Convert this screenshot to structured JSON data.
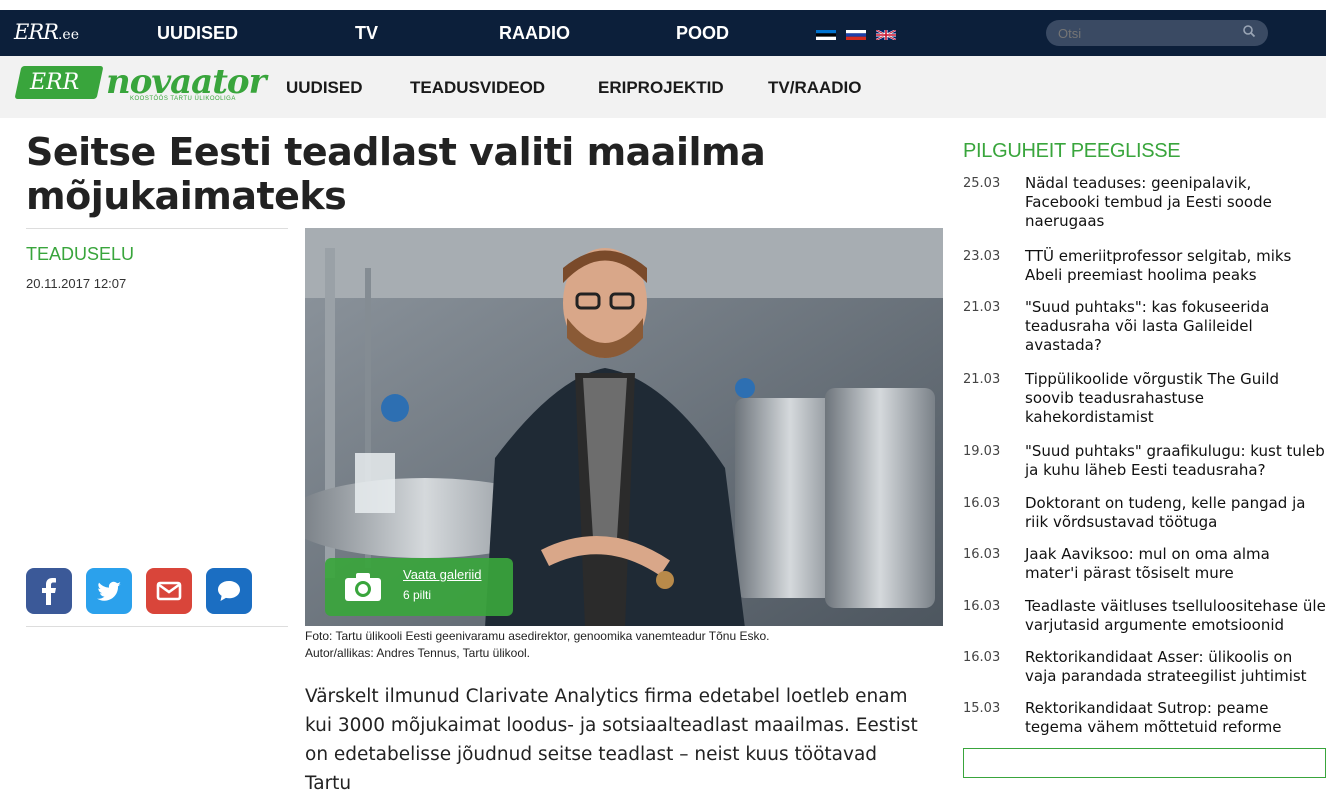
{
  "top_nav": {
    "logo": "ERR",
    "logo_suffix": ".ee",
    "items": [
      "UUDISED",
      "TV",
      "RAADIO",
      "POOD"
    ],
    "search_placeholder": "Otsi"
  },
  "sub_nav": {
    "logo_err": "ERR",
    "logo_name": "novaator",
    "logo_tagline": "KOOSTÖÖS TARTU ÜLIKOOLIGA",
    "items": [
      "UUDISED",
      "TEADUSVIDEOD",
      "ERIPROJEKTID",
      "TV/RAADIO"
    ]
  },
  "article": {
    "title": "Seitse Eesti teadlast valiti maailma mõjukaimateks",
    "category": "TEADUSELU",
    "date": "20.11.2017 12:07",
    "gallery_link": "Vaata galeriid",
    "gallery_count": "6 pilti",
    "caption_line1": "Foto: Tartu ülikooli Eesti geenivaramu asedirektor, genoomika vanemteadur Tõnu Esko.",
    "caption_line2": "Autor/allikas: Andres Tennus, Tartu ülikool.",
    "body": "Värskelt ilmunud Clarivate Analytics firma edetabel loetleb enam kui 3000 mõjukaimat loodus- ja sotsiaalteadlast maailmas. Eestist on edetabelisse jõudnud seitse teadlast – neist kuus töötavad Tartu"
  },
  "social": {
    "icons": [
      "facebook-icon",
      "twitter-icon",
      "email-icon",
      "comment-icon"
    ],
    "colors": [
      "#3b5998",
      "#2ba1ec",
      "#d9453a",
      "#1b6ec2"
    ]
  },
  "sidebar": {
    "title": "PILGUHEIT PEEGLISSE",
    "items": [
      {
        "date": "25.03",
        "title": "Nädal teaduses: geenipalavik, Facebooki tembud ja Eesti soode naerugaas"
      },
      {
        "date": "23.03",
        "title": "TTÜ emeriitprofessor selgitab, miks Abeli preemiast hoolima peaks"
      },
      {
        "date": "21.03",
        "title": "\"Suud puhtaks\": kas fokuseerida teadusraha või lasta Galileidel avastada?"
      },
      {
        "date": "21.03",
        "title": "Tippülikoolide võrgustik The Guild soovib teadusrahastuse kahekordistamist"
      },
      {
        "date": "19.03",
        "title": "\"Suud puhtaks\" graafikulugu: kust tuleb ja kuhu läheb Eesti teadusraha?"
      },
      {
        "date": "16.03",
        "title": "Doktorant on tudeng, kelle pangad ja riik võrdsustavad töötuga"
      },
      {
        "date": "16.03",
        "title": "Jaak Aaviksoo: mul on oma alma mater'i pärast tõsiselt mure"
      },
      {
        "date": "16.03",
        "title": "Teadlaste väitluses tselluloositehase üle varjutasid argumente emotsioonid"
      },
      {
        "date": "16.03",
        "title": "Rektorikandidaat Asser: ülikoolis on vaja parandada strateegilist juhtimist"
      },
      {
        "date": "15.03",
        "title": "Rektorikandidaat Sutrop: peame tegema vähem mõttetuid reforme"
      }
    ]
  },
  "colors": {
    "nav_bg": "#0c1f3a",
    "accent": "#39a53c"
  }
}
